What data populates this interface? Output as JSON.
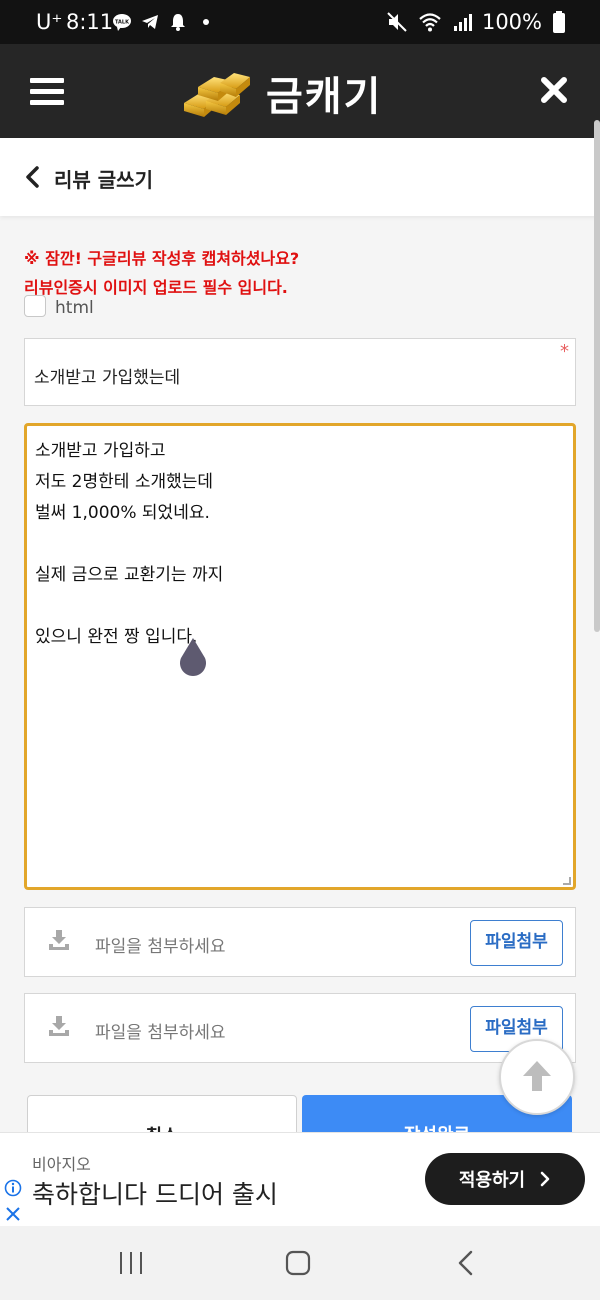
{
  "status_bar": {
    "carrier": "U⁺",
    "time": "8:11",
    "battery": "100%"
  },
  "header": {
    "app_name": "금캐기"
  },
  "subheader": {
    "title": "리뷰 글쓰기"
  },
  "notice": {
    "line1": "※ 잠깐! 구글리뷰 작성후 캡쳐하셨나요?",
    "line2": "리뷰인증시 이미지 업로드 필수 입니다."
  },
  "html_option": {
    "label": "html",
    "checked": false
  },
  "form": {
    "subject_value": "소개받고 가입했는데",
    "required_mark": "*",
    "content_lines": [
      "소개받고 가입하고",
      "저도 2명한테 소개했는데",
      "벌써 1,000% 되었네요.",
      "",
      "실제 금으로 교환기는 까지",
      "",
      "있으니 완전 짱 입니다."
    ]
  },
  "attachments": [
    {
      "placeholder": "파일을 첨부하세요",
      "button": "파일첨부"
    },
    {
      "placeholder": "파일을 첨부하세요",
      "button": "파일첨부"
    }
  ],
  "actions": {
    "cancel": "취소",
    "submit": "작성완료"
  },
  "ad": {
    "source": "비아지오",
    "headline": "축하합니다 드디어 출시",
    "cta": "적용하기"
  },
  "colors": {
    "header_bg": "#262626",
    "notice_red": "#e01010",
    "focus_border": "#e2a62a",
    "primary_blue": "#3d8bf5",
    "file_btn_blue": "#2a6cc4"
  }
}
